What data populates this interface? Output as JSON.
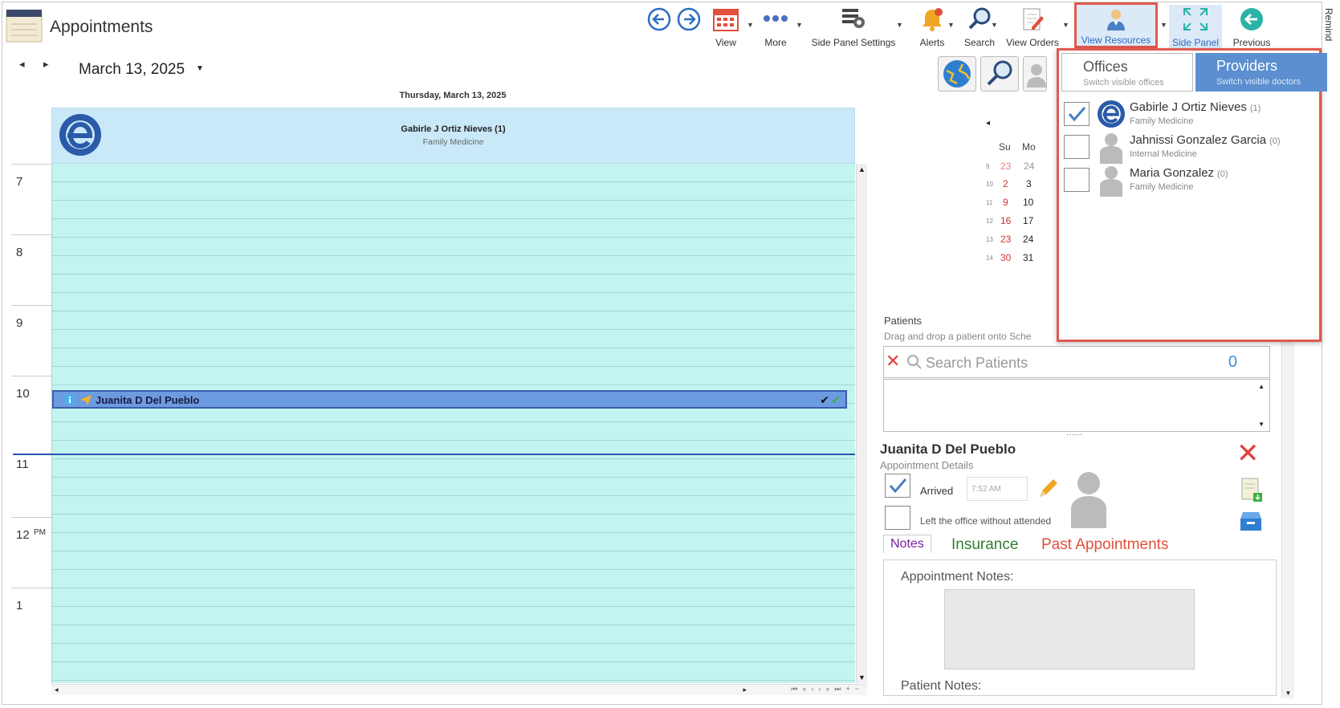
{
  "app": {
    "title": "Appointments"
  },
  "toolbar": {
    "view": "View",
    "more": "More",
    "side_panel_settings": "Side Panel Settings",
    "alerts": "Alerts",
    "search": "Search",
    "view_orders": "View Orders",
    "view_resources": "View Resources",
    "side_panel": "Side Panel",
    "previous": "Previous",
    "reminders": "Remind"
  },
  "colors": {
    "accent": "#5b8fd0",
    "highlight_border": "#e05a4f",
    "grid": "#c4f4ef",
    "appointment": "#6d9be0"
  },
  "calendar": {
    "date": "March 13, 2025",
    "day_header": "Thursday, March 13, 2025",
    "provider_name": "Gabirle J Ortiz Nieves (1)",
    "provider_specialty": "Family Medicine",
    "hours": [
      "7",
      "8",
      "9",
      "10",
      "11",
      "12",
      "1"
    ],
    "pm_marker": "PM",
    "appointment": {
      "patient": "Juanita D Del Pueblo"
    }
  },
  "mini_calendar": {
    "headers": [
      "Su",
      "Mo"
    ],
    "rows": [
      {
        "wk": "9",
        "su": "23",
        "mo": "24"
      },
      {
        "wk": "10",
        "su": "2",
        "mo": "3"
      },
      {
        "wk": "11",
        "su": "9",
        "mo": "10"
      },
      {
        "wk": "12",
        "su": "16",
        "mo": "17"
      },
      {
        "wk": "13",
        "su": "23",
        "mo": "24"
      },
      {
        "wk": "14",
        "su": "30",
        "mo": "31"
      }
    ]
  },
  "patients": {
    "label": "Patients",
    "hint": "Drag and drop a patient onto Sche",
    "search_placeholder": "Search Patients",
    "count": "0"
  },
  "appointment_details": {
    "patient_name": "Juanita D Del Pueblo",
    "subtitle": "Appointment Details",
    "arrived_label": "Arrived",
    "arrived_time": "7:52 AM",
    "left_label": "Left the office without attended",
    "tabs": [
      "Notes",
      "Insurance",
      "Past Appointments"
    ],
    "appointment_notes_label": "Appointment Notes:",
    "patient_notes_label": "Patient Notes:"
  },
  "resources_panel": {
    "offices": {
      "title": "Offices",
      "subtitle": "Switch visible offices"
    },
    "providers": {
      "title": "Providers",
      "subtitle": "Switch visible doctors"
    },
    "items": [
      {
        "name": "Gabirle J Ortiz Nieves",
        "count": "(1)",
        "specialty": "Family Medicine",
        "checked": true
      },
      {
        "name": "Jahnissi Gonzalez Garcia",
        "count": "(0)",
        "specialty": "Internal Medicine",
        "checked": false
      },
      {
        "name": "Maria Gonzalez",
        "count": "(0)",
        "specialty": "Family Medicine",
        "checked": false
      }
    ]
  }
}
